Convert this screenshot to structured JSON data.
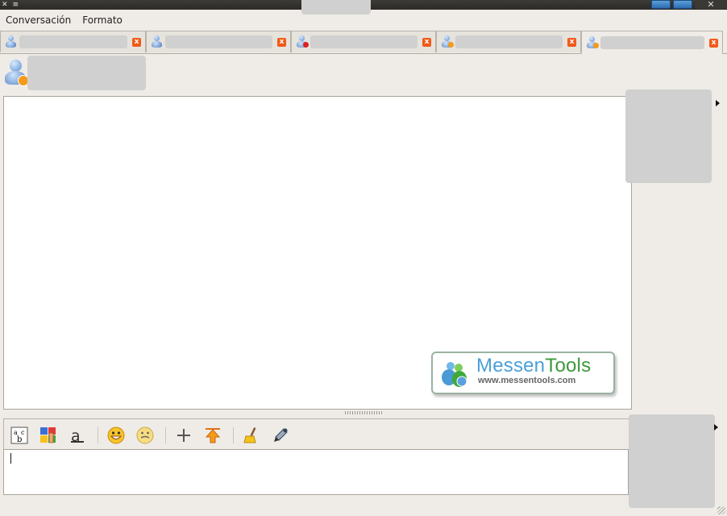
{
  "window": {
    "title": "",
    "controls": [
      "minimize",
      "maximize",
      "close"
    ]
  },
  "menu": [
    {
      "label": "Conversación"
    },
    {
      "label": "Formato"
    }
  ],
  "tabs": [
    {
      "label": "",
      "status": "online"
    },
    {
      "label": "",
      "status": "online"
    },
    {
      "label": "",
      "status": "busy"
    },
    {
      "label": "",
      "status": "away"
    },
    {
      "label": "",
      "status": "away",
      "active": true
    }
  ],
  "contact": {
    "name": "",
    "status": "away"
  },
  "watermark": {
    "brand_a": "Messen",
    "brand_b": "Tools",
    "url": "www.messentools.com"
  },
  "toolbar": {
    "icons": [
      "font-icon",
      "font-color-icon",
      "font-style-icon",
      "emoticon-icon",
      "wink-icon",
      "invite-icon",
      "send-file-icon",
      "clear-conversation-icon",
      "color-picker-icon"
    ]
  },
  "input": {
    "value": ""
  },
  "colors": {
    "accent": "#2b6cb0",
    "close": "#f25a1a",
    "busy": "#e02020",
    "away": "#f59a1a"
  }
}
